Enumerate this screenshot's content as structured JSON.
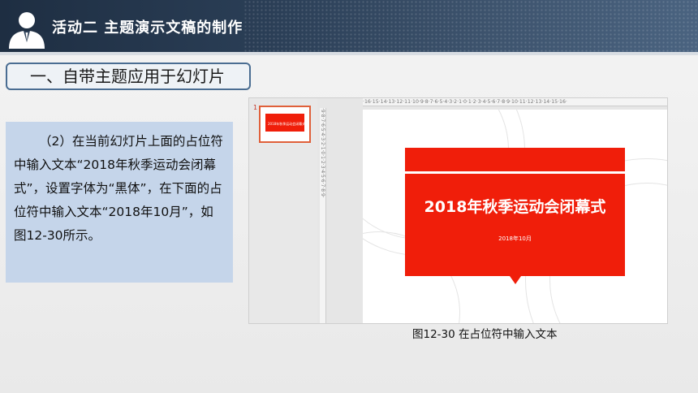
{
  "header": {
    "title": "活动二  主题演示文稿的制作"
  },
  "section": {
    "label": "一、自带主题应用于幻灯片"
  },
  "instruction": {
    "text": "（2）在当前幻灯片上面的占位符中输入文本“2018年秋季运动会闭幕式”，设置字体为“黑体”，在下面的占位符中输入文本“2018年10月”，如图12-30所示。"
  },
  "screenshot": {
    "slide_number": "1",
    "h_ruler": "·16·15·14·13·12·11·10·9·8·7·6·5·4·3·2·1·0·1·2·3·4·5·6·7·8·9·10·11·12·13·14·15·16·",
    "v_ruler": "·9·8·7·6·5·4·3·2·1·0·1·2·3·4·5·6·7·8·9·",
    "slide_title": "2018年秋季运动会闭幕式",
    "slide_subtitle": "2018年10月",
    "thumb_title": "2018年秋季运动会闭幕式"
  },
  "caption": {
    "text": "图12-30  在占位符中输入文本"
  },
  "colors": {
    "header_bg": "#2b3f57",
    "accent_red": "#f01e0a",
    "text_box_bg": "#c5d5ea",
    "pill_border": "#4a6d92"
  }
}
